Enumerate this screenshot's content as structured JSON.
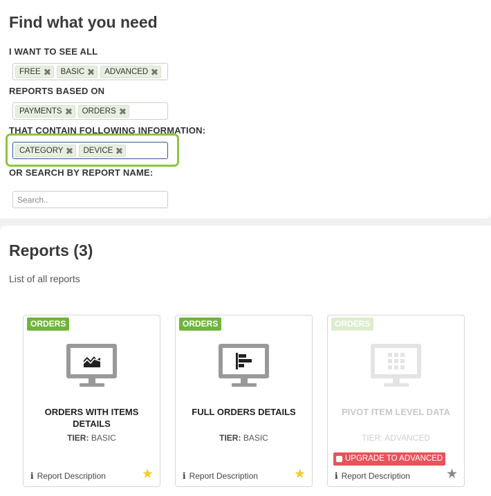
{
  "filters": {
    "title": "Find what you need",
    "see_all_label": "I WANT TO SEE ALL",
    "see_all_tags": [
      "FREE",
      "BASIC",
      "ADVANCED"
    ],
    "based_on_label": "REPORTS BASED ON",
    "based_on_tags": [
      "PAYMENTS",
      "ORDERS"
    ],
    "contain_label": "THAT CONTAIN FOLLOWING INFORMATION:",
    "contain_tags": [
      "CATEGORY",
      "DEVICE"
    ],
    "search_label": "OR SEARCH BY REPORT NAME:",
    "search_placeholder": "Search..",
    "search_value": ""
  },
  "reports": {
    "title": "Reports (3)",
    "subtitle": "List of all reports",
    "cards": [
      {
        "badge": "ORDERS",
        "title": "ORDERS WITH ITEMS DETAILS",
        "tier_label": "TIER:",
        "tier_value": "BASIC",
        "description_link": "Report Description",
        "icon": "area-chart-icon",
        "favorite": true
      },
      {
        "badge": "ORDERS",
        "title": "FULL ORDERS DETAILS",
        "tier_label": "TIER:",
        "tier_value": "BASIC",
        "description_link": "Report Description",
        "icon": "bar-chart-icon",
        "favorite": true
      },
      {
        "badge": "ORDERS",
        "title": "PIVOT ITEM LEVEL DATA",
        "tier_label": "TIER:",
        "tier_value": "ADVANCED",
        "upgrade_label": "UPGRADE TO ADVANCED",
        "description_link": "Report Description",
        "icon": "grid-icon",
        "favorite": false,
        "disabled": true
      }
    ]
  },
  "colors": {
    "badge_green": "#6fb53c",
    "highlight_green": "#8cc63f",
    "upgrade_red": "#e8535a",
    "star_yellow": "#f1cc2e"
  }
}
